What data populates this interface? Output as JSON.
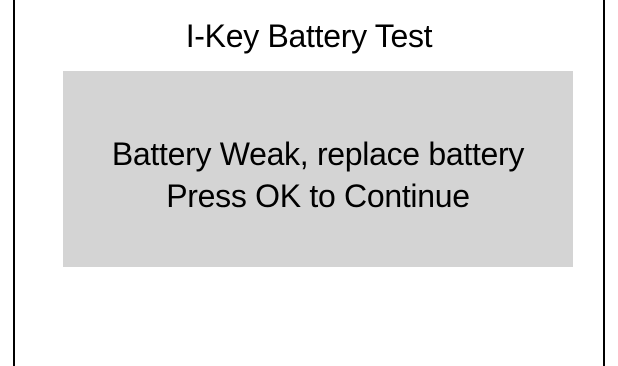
{
  "dialog": {
    "title": "I-Key Battery Test",
    "message_line_1": "Battery Weak, replace battery",
    "message_line_2": "Press OK to Continue"
  },
  "colors": {
    "background": "#ffffff",
    "message_box": "#d4d4d4",
    "text": "#000000",
    "border": "#000000"
  }
}
